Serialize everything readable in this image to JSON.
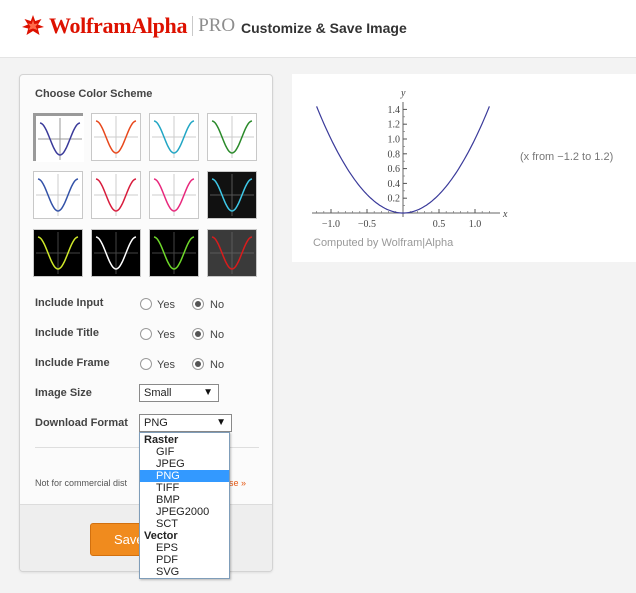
{
  "header": {
    "logo_word": "WolframAlpha",
    "logo_pro": "PRO",
    "page_title": "Customize & Save Image",
    "brand_color": "#dd1100"
  },
  "panel": {
    "title": "Choose Color Scheme",
    "swatches": [
      {
        "bg": "#ffffff",
        "curve": "#3a3a9a",
        "grid": "#9a9a9a",
        "selected": true
      },
      {
        "bg": "#ffffff",
        "curve": "#e8481c",
        "grid": "#cccccc",
        "selected": false
      },
      {
        "bg": "#ffffff",
        "curve": "#22a6c4",
        "grid": "#cccccc",
        "selected": false
      },
      {
        "bg": "#ffffff",
        "curve": "#2a8a2a",
        "grid": "#cccccc",
        "selected": false
      },
      {
        "bg": "#ffffff",
        "curve": "#3352a8",
        "grid": "#cccccc",
        "selected": false
      },
      {
        "bg": "#ffffff",
        "curve": "#d81c3c",
        "grid": "#cccccc",
        "selected": false
      },
      {
        "bg": "#ffffff",
        "curve": "#e8287c",
        "grid": "#cccccc",
        "selected": false
      },
      {
        "bg": "#111111",
        "curve": "#3ec8e8",
        "grid": "#555555",
        "selected": false
      },
      {
        "bg": "#000000",
        "curve": "#cfe82a",
        "grid": "#444444",
        "selected": false
      },
      {
        "bg": "#000000",
        "curve": "#ffffff",
        "grid": "#444444",
        "selected": false
      },
      {
        "bg": "#000000",
        "curve": "#6ed82a",
        "grid": "#444444",
        "selected": false
      },
      {
        "bg": "#3a3a3a",
        "curve": "#d81c1c",
        "grid": "#5a5a5a",
        "selected": false
      }
    ],
    "options": {
      "include_input": {
        "label": "Include Input",
        "yes": "Yes",
        "no": "No",
        "value": "No"
      },
      "include_title": {
        "label": "Include Title",
        "yes": "Yes",
        "no": "No",
        "value": "No"
      },
      "include_frame": {
        "label": "Include Frame",
        "yes": "Yes",
        "no": "No",
        "value": "No"
      }
    },
    "image_size": {
      "label": "Image Size",
      "value": "Small"
    },
    "download_format": {
      "label": "Download Format",
      "value": "PNG"
    },
    "note_text": "Not for commercial dist",
    "note_link": "se »",
    "save_label": "Save"
  },
  "dropdown": {
    "groups": [
      {
        "label": "Raster",
        "items": [
          "GIF",
          "JPEG",
          "PNG",
          "TIFF",
          "BMP",
          "JPEG2000",
          "SCT"
        ]
      },
      {
        "label": "Vector",
        "items": [
          "EPS",
          "PDF",
          "SVG"
        ]
      }
    ],
    "selected": "PNG"
  },
  "preview": {
    "range_text": "(x from −1.2 to 1.2)",
    "computed_by": "Computed by Wolfram|Alpha",
    "chart_data": {
      "type": "line",
      "function": "x^2",
      "x_range": [
        -1.2,
        1.2
      ],
      "y_ticks": [
        "0.2",
        "0.4",
        "0.6",
        "0.8",
        "1.0",
        "1.2",
        "1.4"
      ],
      "x_ticks": [
        "−1.0",
        "−0.5",
        "0.5",
        "1.0"
      ],
      "xlabel": "x",
      "ylabel": "y",
      "color": "#3a3a9a"
    }
  }
}
